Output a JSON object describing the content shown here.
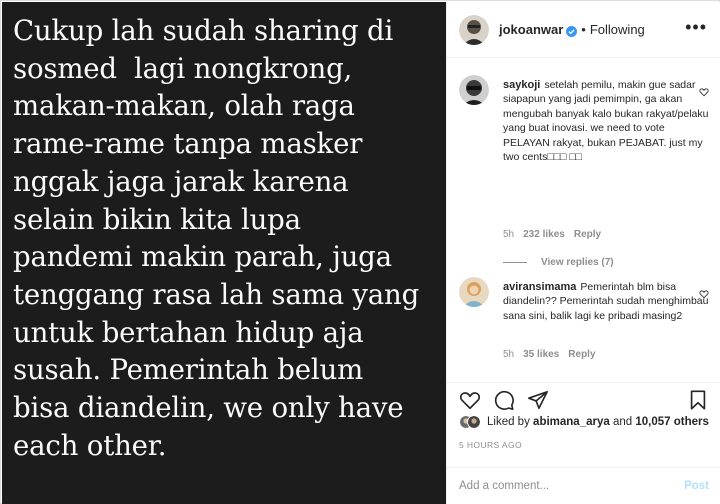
{
  "post": {
    "image_text": "Cukup lah sudah sharing di\nsosmed  lagi nongkrong,\nmakan-makan, olah raga\nrame-rame tanpa masker\nnggak jaga jarak karena\nselain bikin kita lupa\npandemi makin parah, juga\ntenggang rasa lah sama yang\nuntuk bertahan hidup aja\nsusah. Pemerintah belum\nbisa diandelin, we only have\neach other."
  },
  "header": {
    "username": "jokoanwar",
    "separator": "•",
    "follow_status": "Following",
    "more": "•••"
  },
  "comments": [
    {
      "username": "saykoji",
      "text": "setelah pemilu, makin gue sadar siapapun yang jadi pemimpin, ga akan mengubah banyak kalo bukan rakyat/pelaku yang buat inovasi. we need to vote PELAYAN rakyat, bukan PEJABAT. just my two cents□□□ □□",
      "time": "5h",
      "likes": "232 likes",
      "reply": "Reply",
      "view_replies": "View replies (7)"
    },
    {
      "username": "aviransimama",
      "text": "Pemerintah blm bisa diandelin?? Pemerintah sudah menghimbau sana sini, balik lagi ke pribadi masing2",
      "time": "5h",
      "likes": "35 likes",
      "reply": "Reply"
    }
  ],
  "likes": {
    "prefix": "Liked by",
    "user": "abimana_arya",
    "middle": "and",
    "count": "10,057 others"
  },
  "timestamp": "5 HOURS AGO",
  "comment_box": {
    "placeholder": "Add a comment...",
    "post_label": "Post"
  },
  "colors": {
    "verified": "#3897f0",
    "link_disabled": "#b2dffc",
    "muted": "#8e8e8e"
  }
}
